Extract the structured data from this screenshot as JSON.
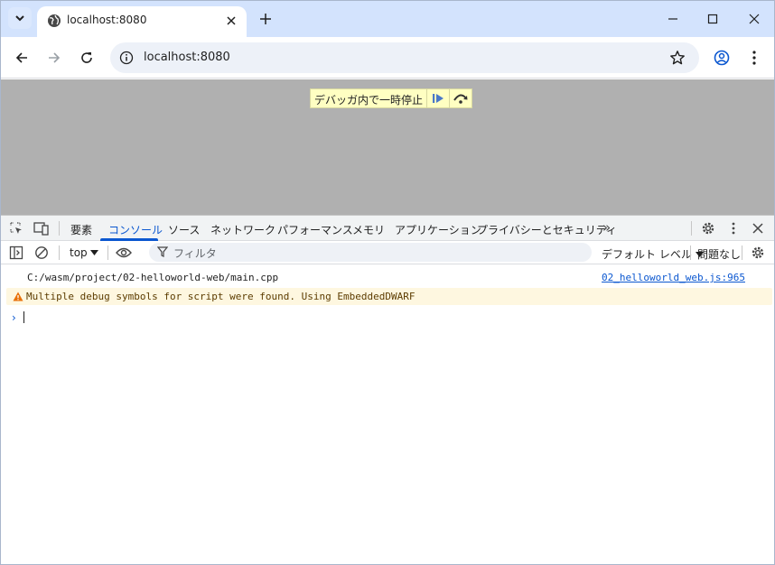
{
  "browser": {
    "tab_title": "localhost:8080",
    "url": "localhost:8080"
  },
  "page": {
    "paused_message": "デバッガ内で一時停止"
  },
  "devtools": {
    "tabs": [
      "要素",
      "コンソール",
      "ソース",
      "ネットワーク",
      "パフォーマンス",
      "メモリ",
      "アプリケーション",
      "プライバシーとセキュリティ"
    ],
    "active_tab": "コンソール",
    "more_tabs": "»",
    "context": "top",
    "filter_placeholder": "フィルタ",
    "levels": "デフォルト レベル",
    "issues": "問題なし"
  },
  "console": {
    "lines": [
      {
        "text": "C:/wasm/project/02-helloworld-web/main.cpp",
        "source": "02_helloworld_web.js:965"
      },
      {
        "text": "Multiple debug symbols for script were found. Using EmbeddedDWARF",
        "level": "warning"
      }
    ],
    "prompt": "›"
  },
  "colors": {
    "tabstrip": "#d3e3fd",
    "accent": "#0b57d0",
    "viewport": "#b0b0b0",
    "paused_bg": "#ffffc2",
    "warning_bg": "#fef7e0"
  }
}
